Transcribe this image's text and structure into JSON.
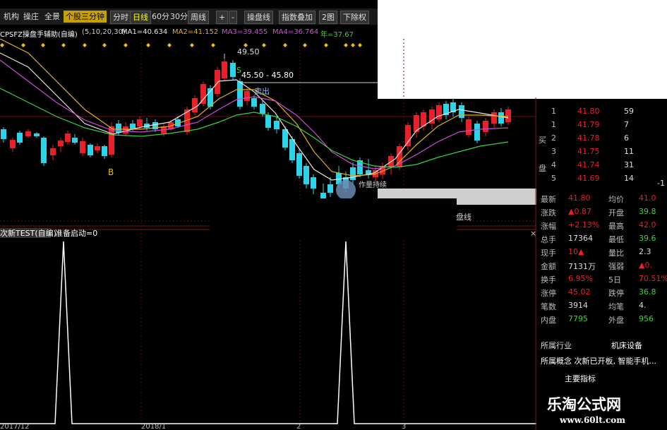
{
  "toolbar": {
    "items": [
      "机构",
      "操庄",
      "全景",
      "个股三分钟",
      "分时",
      "日线",
      "60分",
      "30分",
      "周线",
      "+",
      "-",
      "操盘线",
      "指数叠加",
      "2图",
      "下除权"
    ]
  },
  "main_indicator": {
    "name": "CPSFZ操盘手辅助(自编)",
    "params": "(5,10,20,30)",
    "ma1": "MA1=40.634",
    "ma2": "MA2=41.152",
    "ma3": "MA3=39.455",
    "ma4": "MA4=36.764",
    "extra": "年=37.67"
  },
  "chart_labels": {
    "high": "49.50",
    "range": "45.50 - 45.80",
    "sell": "卖出",
    "s_mark": "S",
    "b_mark": "B",
    "low_note": "作量持续",
    "panel_suffix": "盘线"
  },
  "sub_indicator": {
    "name": "次新TEST(自编)",
    "status": "准备启动=0",
    "close_icon": "×"
  },
  "xaxis": [
    "2017/12",
    "2018/1",
    "2",
    "3"
  ],
  "quote_levels": [
    {
      "no": "1",
      "price": "41.80",
      "vol": "59"
    },
    {
      "no": "1",
      "price": "41.79",
      "vol": "7"
    },
    {
      "no": "2",
      "price": "41.78",
      "vol": "6"
    },
    {
      "no": "3",
      "price": "41.75",
      "vol": "11"
    },
    {
      "no": "4",
      "price": "41.74",
      "vol": "31"
    },
    {
      "no": "5",
      "price": "41.69",
      "vol": "14"
    }
  ],
  "side_labels": {
    "buy1": "买",
    "buy2": "盘",
    "sep": "-1"
  },
  "quote_stats": [
    {
      "l1": "最新",
      "v1": "41.80",
      "l2": "均价",
      "v2": "41.0"
    },
    {
      "l1": "涨跌",
      "v1": "▲0.87",
      "l2": "开盘",
      "v2": "39.8"
    },
    {
      "l1": "涨幅",
      "v1": "+2.13%",
      "l2": "最高",
      "v2": "42.0"
    },
    {
      "l1": "总手",
      "v1": "17364",
      "l2": "最低",
      "v2": "39.6"
    },
    {
      "l1": "现手",
      "v1": "10▲",
      "l2": "量比",
      "v2": "2.3"
    },
    {
      "l1": "金额",
      "v1": "7131万",
      "l2": "强弱",
      "v2": "▲0."
    },
    {
      "l1": "换手",
      "v1": "6.95%",
      "l2": "5日",
      "v2": "70.51%"
    },
    {
      "l1": "涨停",
      "v1": "45.02",
      "l2": "跌停",
      "v2": "36.8"
    },
    {
      "l1": "笔数",
      "v1": "3914",
      "l2": "均笔",
      "v2": "4."
    },
    {
      "l1": "内盘",
      "v1": "7795",
      "l2": "外盘",
      "v2": "956"
    }
  ],
  "industry": {
    "label": "所属行业",
    "value": "机床设备"
  },
  "concept": "所属概念  次新已开板, 智能手机...",
  "main_indicators_btn": "主要指标",
  "watermark": {
    "title": "乐淘公式网",
    "url": "www.60lt.com"
  },
  "colors": {
    "up": "#e8202a",
    "down": "#2dd3e8",
    "ma1": "#e6e6e6",
    "ma2": "#e0b020",
    "ma3": "#d04ad8",
    "ma4": "#3bd23b"
  }
}
